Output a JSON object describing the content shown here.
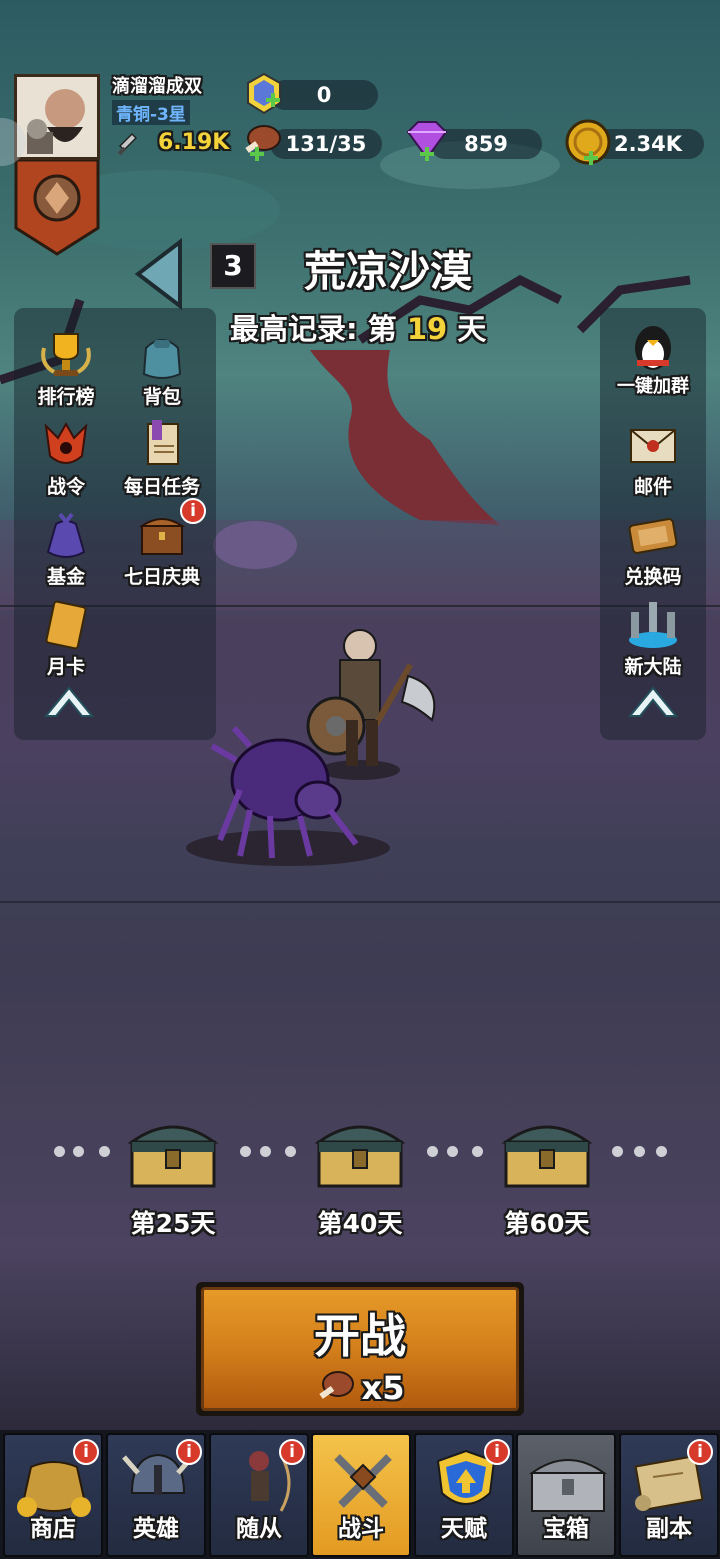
{
  "player": {
    "name": "滴溜溜成双",
    "rank": "青铜-3星",
    "power": "6.19K"
  },
  "resources": {
    "hex_gems": "0",
    "meat": "131/35",
    "diamonds": "859",
    "gold": "2.34K"
  },
  "stage": {
    "number": "3",
    "name": "荒凉沙漠",
    "record_prefix": "最高记录: 第",
    "record_day": "19",
    "record_suffix": "天"
  },
  "left_menu": [
    {
      "label": "排行榜",
      "icon": "trophy-icon"
    },
    {
      "label": "背包",
      "icon": "backpack-icon"
    },
    {
      "label": "战令",
      "icon": "battle-pass-icon"
    },
    {
      "label": "每日任务",
      "icon": "daily-task-icon"
    },
    {
      "label": "基金",
      "icon": "fund-bag-icon"
    },
    {
      "label": "七日庆典",
      "icon": "chest-icon"
    },
    {
      "label": "月卡",
      "icon": "month-card-icon"
    }
  ],
  "right_menu": [
    {
      "label": "一键加群",
      "icon": "penguin-icon"
    },
    {
      "label": "邮件",
      "icon": "mail-icon"
    },
    {
      "label": "兑换码",
      "icon": "ticket-icon"
    },
    {
      "label": "新大陆",
      "icon": "portal-icon"
    }
  ],
  "chests": [
    {
      "label": "第25天"
    },
    {
      "label": "第40天"
    },
    {
      "label": "第60天"
    }
  ],
  "start_button": {
    "label": "开战",
    "cost": "x5"
  },
  "badge_text": "i",
  "nav": [
    {
      "label": "商店",
      "badge": true
    },
    {
      "label": "英雄",
      "badge": true
    },
    {
      "label": "随从",
      "badge": true
    },
    {
      "label": "战斗",
      "badge": false,
      "active": true
    },
    {
      "label": "天赋",
      "badge": true
    },
    {
      "label": "宝箱",
      "badge": false
    },
    {
      "label": "副本",
      "badge": true
    }
  ],
  "colors": {
    "record_day": "#f4d23a",
    "power": "#f4d23a",
    "rank": "#6fb6ff",
    "active_tab": "#f4c34a"
  }
}
